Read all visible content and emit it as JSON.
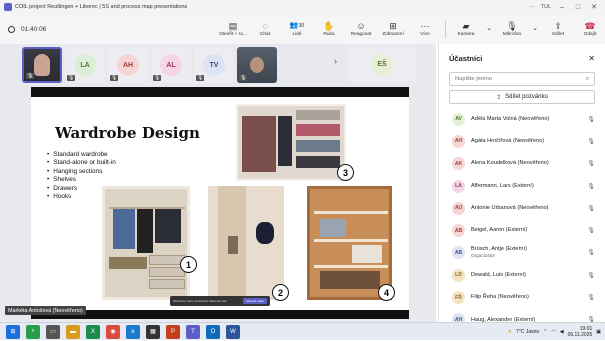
{
  "window": {
    "title": "COIL project Reutlingen + Liberec | 5S and process map presentations",
    "right_label": "TUL"
  },
  "toolbar": {
    "timer": "01:40:06",
    "buttons": [
      {
        "label": "Otevřít + ru...",
        "icon": "apps-icon"
      },
      {
        "label": "Chat",
        "icon": "chat-icon"
      },
      {
        "label": "Lidé",
        "icon": "people-icon",
        "count": "30"
      },
      {
        "label": "Ruka",
        "icon": "raise-hand-icon"
      },
      {
        "label": "Reagovat",
        "icon": "react-icon"
      },
      {
        "label": "Zobrazení",
        "icon": "view-icon"
      },
      {
        "label": "Více",
        "icon": "more-icon"
      }
    ],
    "media": [
      {
        "label": "Kamera",
        "icon": "camera-off-icon"
      },
      {
        "label": "Mikrofon",
        "icon": "mic-off-icon"
      }
    ],
    "share_label": "Sdílet",
    "leave_label": "Odejít"
  },
  "gallery": {
    "tiles": [
      {
        "initials": "LD",
        "color": "#f2e3c4",
        "fg": "#8a6a1e"
      },
      {
        "initials": "LA",
        "color": "#dcefd6",
        "fg": "#4a7a3a"
      },
      {
        "initials": "AH",
        "color": "#f6d6d4",
        "fg": "#a33a33"
      },
      {
        "initials": "AL",
        "color": "#f5d6e4",
        "fg": "#a13466"
      },
      {
        "initials": "",
        "photo": true
      },
      {
        "initials": "TV",
        "color": "#dde3f3",
        "fg": "#3a4f8a"
      },
      {
        "initials": "",
        "photo2": true
      }
    ],
    "extra_tile": {
      "initials": "EŠ",
      "color": "#e7f0d4",
      "fg": "#5a7530"
    }
  },
  "slide": {
    "title": "Wardrobe Design",
    "bullets": [
      "Standard wardrobe",
      "Stand-alone or built-in",
      "Hanging sections",
      "Shelves",
      "Drawers",
      "Hooks"
    ],
    "numbers": [
      "1",
      "2",
      "3",
      "4"
    ]
  },
  "toast": {
    "text": "Ukončete celou obrazovku klávesou Esc",
    "button": "Ukončit celou"
  },
  "speaker_label": "Markéta Antošová (Neověřeno)",
  "panel": {
    "title": "Účastníci",
    "search_placeholder": "Napište jméno",
    "invite_label": "Sdílet pozvánku",
    "participants": [
      {
        "initials": "AV",
        "name": "Adéla Marta Volná (Neověřeno)",
        "color": "#e4efd4",
        "fg": "#4f7a2a"
      },
      {
        "initials": "AH",
        "name": "Agáta Hrnčířová (Neověřeno)",
        "color": "#f6d6d4",
        "fg": "#a33a33"
      },
      {
        "initials": "AK",
        "name": "Alena Koudelková (Neověřeno)",
        "color": "#f6d6d4",
        "fg": "#a33a33"
      },
      {
        "initials": "LA",
        "name": "Affermann, Lars (Externí)",
        "color": "#f5d6e4",
        "fg": "#a13466"
      },
      {
        "initials": "AU",
        "name": "Antonie Urbanová (Neověřeno)",
        "color": "#f6d6d4",
        "fg": "#a33a33"
      },
      {
        "initials": "AB",
        "name": "Beigel, Aaron (Externí)",
        "color": "#f6d6d4",
        "fg": "#a33a33"
      },
      {
        "initials": "AB",
        "name": "Brüsch, Antje (Externí)",
        "sub": "Organizátor",
        "color": "#dde3f3",
        "fg": "#3a4f8a"
      },
      {
        "initials": "LD",
        "name": "Dewald, Luis (Externí)",
        "color": "#f2e3c4",
        "fg": "#8a6a1e"
      },
      {
        "initials": "FŘ",
        "name": "Filip Řeha (Neověřeno)",
        "color": "#f2e3c4",
        "fg": "#8a6a1e"
      },
      {
        "initials": "AH",
        "name": "Haug, Alexander (Externí)",
        "color": "#dde3f3",
        "fg": "#3a4f8a"
      }
    ]
  },
  "taskbar": {
    "weather": "7°C  Jasno",
    "time": "19:01",
    "date": "06.11.2025"
  }
}
